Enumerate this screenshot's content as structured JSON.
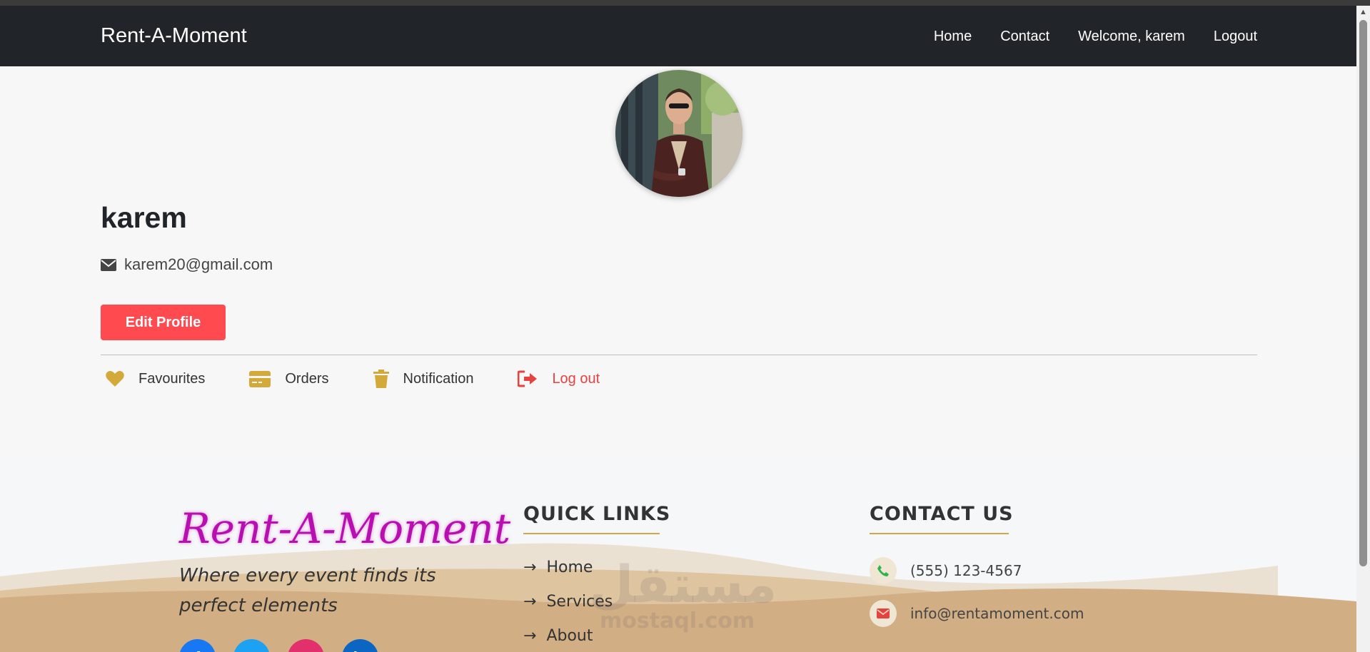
{
  "navbar": {
    "brand": "Rent-A-Moment",
    "links": [
      "Home",
      "Contact",
      "Welcome, karem",
      "Logout"
    ]
  },
  "profile": {
    "name": "karem",
    "email": "karem20@gmail.com",
    "edit_button": "Edit Profile"
  },
  "menu": {
    "items": [
      {
        "label": "Favourites",
        "icon": "heart-icon"
      },
      {
        "label": "Orders",
        "icon": "credit-card-icon"
      },
      {
        "label": "Notification",
        "icon": "trash-icon"
      },
      {
        "label": "Log out",
        "icon": "sign-out-icon"
      }
    ]
  },
  "footer": {
    "brand": "Rent-A-Moment",
    "tagline": "Where every event finds its perfect elements",
    "quick_links_heading": "QUICK LINKS",
    "quick_links": [
      "Home",
      "Services",
      "About"
    ],
    "contact_heading": "CONTACT US",
    "phone": "(555) 123-4567",
    "email": "info@rentamoment.com",
    "social_icons": [
      "facebook-icon",
      "twitter-icon",
      "instagram-icon",
      "linkedin-icon"
    ],
    "watermark": "مستقل",
    "watermark_sub": "mostaql.com"
  },
  "colors": {
    "navbar": "#212529",
    "accent_red": "#ff4a4f",
    "icon_gold": "#d3a93a",
    "brand_magenta": "#b80fb0"
  }
}
